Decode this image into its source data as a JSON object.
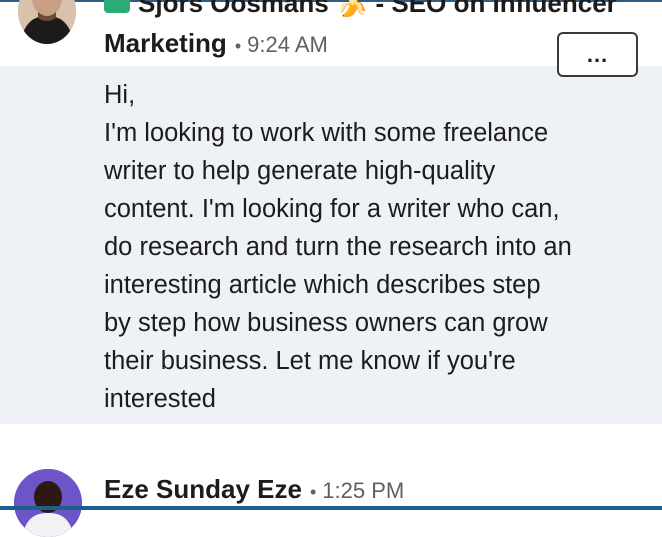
{
  "previous_message": {
    "name_fragment": "Sjors Oosmans 🍌 - SEO on Influencer"
  },
  "message": {
    "sender": "Marketing",
    "time": "9:24 AM",
    "more_label": "...",
    "lines": [
      "Hi,",
      "I'm looking to work with some freelance",
      "writer to help generate high-quality",
      "content. I'm looking for a writer who can,",
      "do research and turn the research into an",
      "interesting article which describes step",
      "by step how business owners can grow",
      "their business. Let me know if you're",
      "interested"
    ]
  },
  "next_message": {
    "sender": "Eze Sunday Eze",
    "time": "1:25 PM"
  },
  "colors": {
    "highlight_background": "#eef2f6",
    "online_badge": "#2bac76",
    "bottom_rule": "#1f5f8f"
  }
}
